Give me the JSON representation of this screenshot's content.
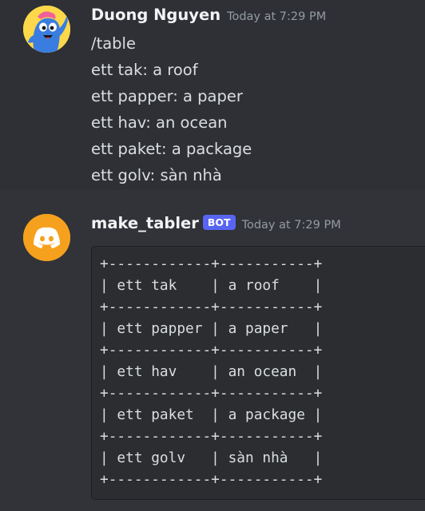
{
  "messages": [
    {
      "author": "Duong Nguyen",
      "timestamp": "Today at 7:29 PM",
      "avatar_icon": "blue-creature-avatar",
      "avatar_bg": "#fdd84a",
      "lines": [
        "/table",
        "ett tak: a roof",
        "ett papper: a paper",
        "ett hav: an ocean",
        "ett paket: a package",
        "ett golv: sàn nhà"
      ]
    },
    {
      "author": "make_tabler",
      "badge": "BOT",
      "timestamp": "Today at 7:29 PM",
      "avatar_icon": "discord-logo-icon",
      "avatar_bg": "#f6a11d",
      "code_lines": [
        "+------------+-----------+",
        "| ett tak    | a roof    |",
        "+------------+-----------+",
        "| ett papper | a paper   |",
        "+------------+-----------+",
        "| ett hav    | an ocean  |",
        "+------------+-----------+",
        "| ett paket  | a package |",
        "+------------+-----------+",
        "| ett golv   | sàn nhà   |",
        "+------------+-----------+"
      ]
    }
  ],
  "colors": {
    "background": "#313338",
    "hover_background": "#2e3035",
    "code_background": "#2b2d31",
    "bot_badge": "#5865f2",
    "username": "#f2f3f5",
    "text": "#dbdee1",
    "timestamp": "#949ba4"
  }
}
